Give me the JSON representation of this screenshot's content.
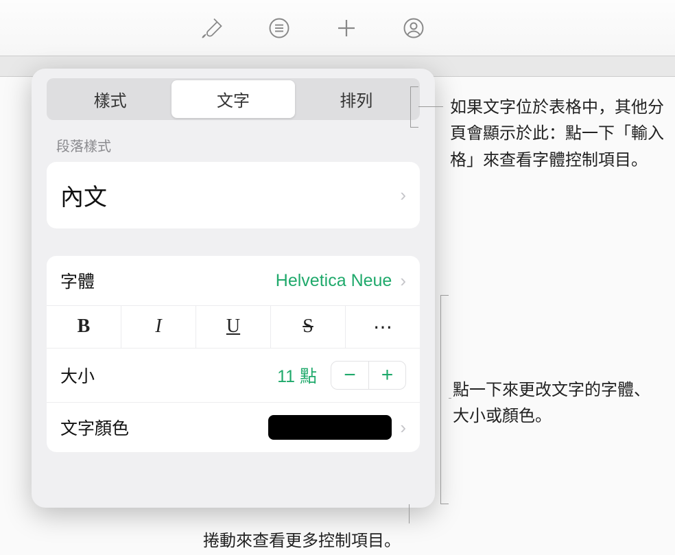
{
  "toolbar": {
    "icons": [
      "paintbrush-icon",
      "list-icon",
      "plus-icon",
      "collaborate-icon"
    ]
  },
  "tabs": {
    "style": "樣式",
    "text": "文字",
    "arrange": "排列"
  },
  "paragraph": {
    "section_label": "段落樣式",
    "value": "內文"
  },
  "font": {
    "label": "字體",
    "value": "Helvetica Neue",
    "style_letters": {
      "bold": "B",
      "italic": "I",
      "underline": "U",
      "strike": "S",
      "more": "⋯"
    }
  },
  "size": {
    "label": "大小",
    "value": "11 點",
    "minus": "−",
    "plus": "+"
  },
  "text_color": {
    "label": "文字顏色",
    "value_hex": "#000000"
  },
  "callouts": {
    "tabs": "如果文字位於表格中，其他分頁會顯示於此：點一下「輸入格」來查看字體控制項目。",
    "font_controls": "點一下來更改文字的字體、大小或顏色。",
    "scroll": "捲動來查看更多控制項目。"
  }
}
